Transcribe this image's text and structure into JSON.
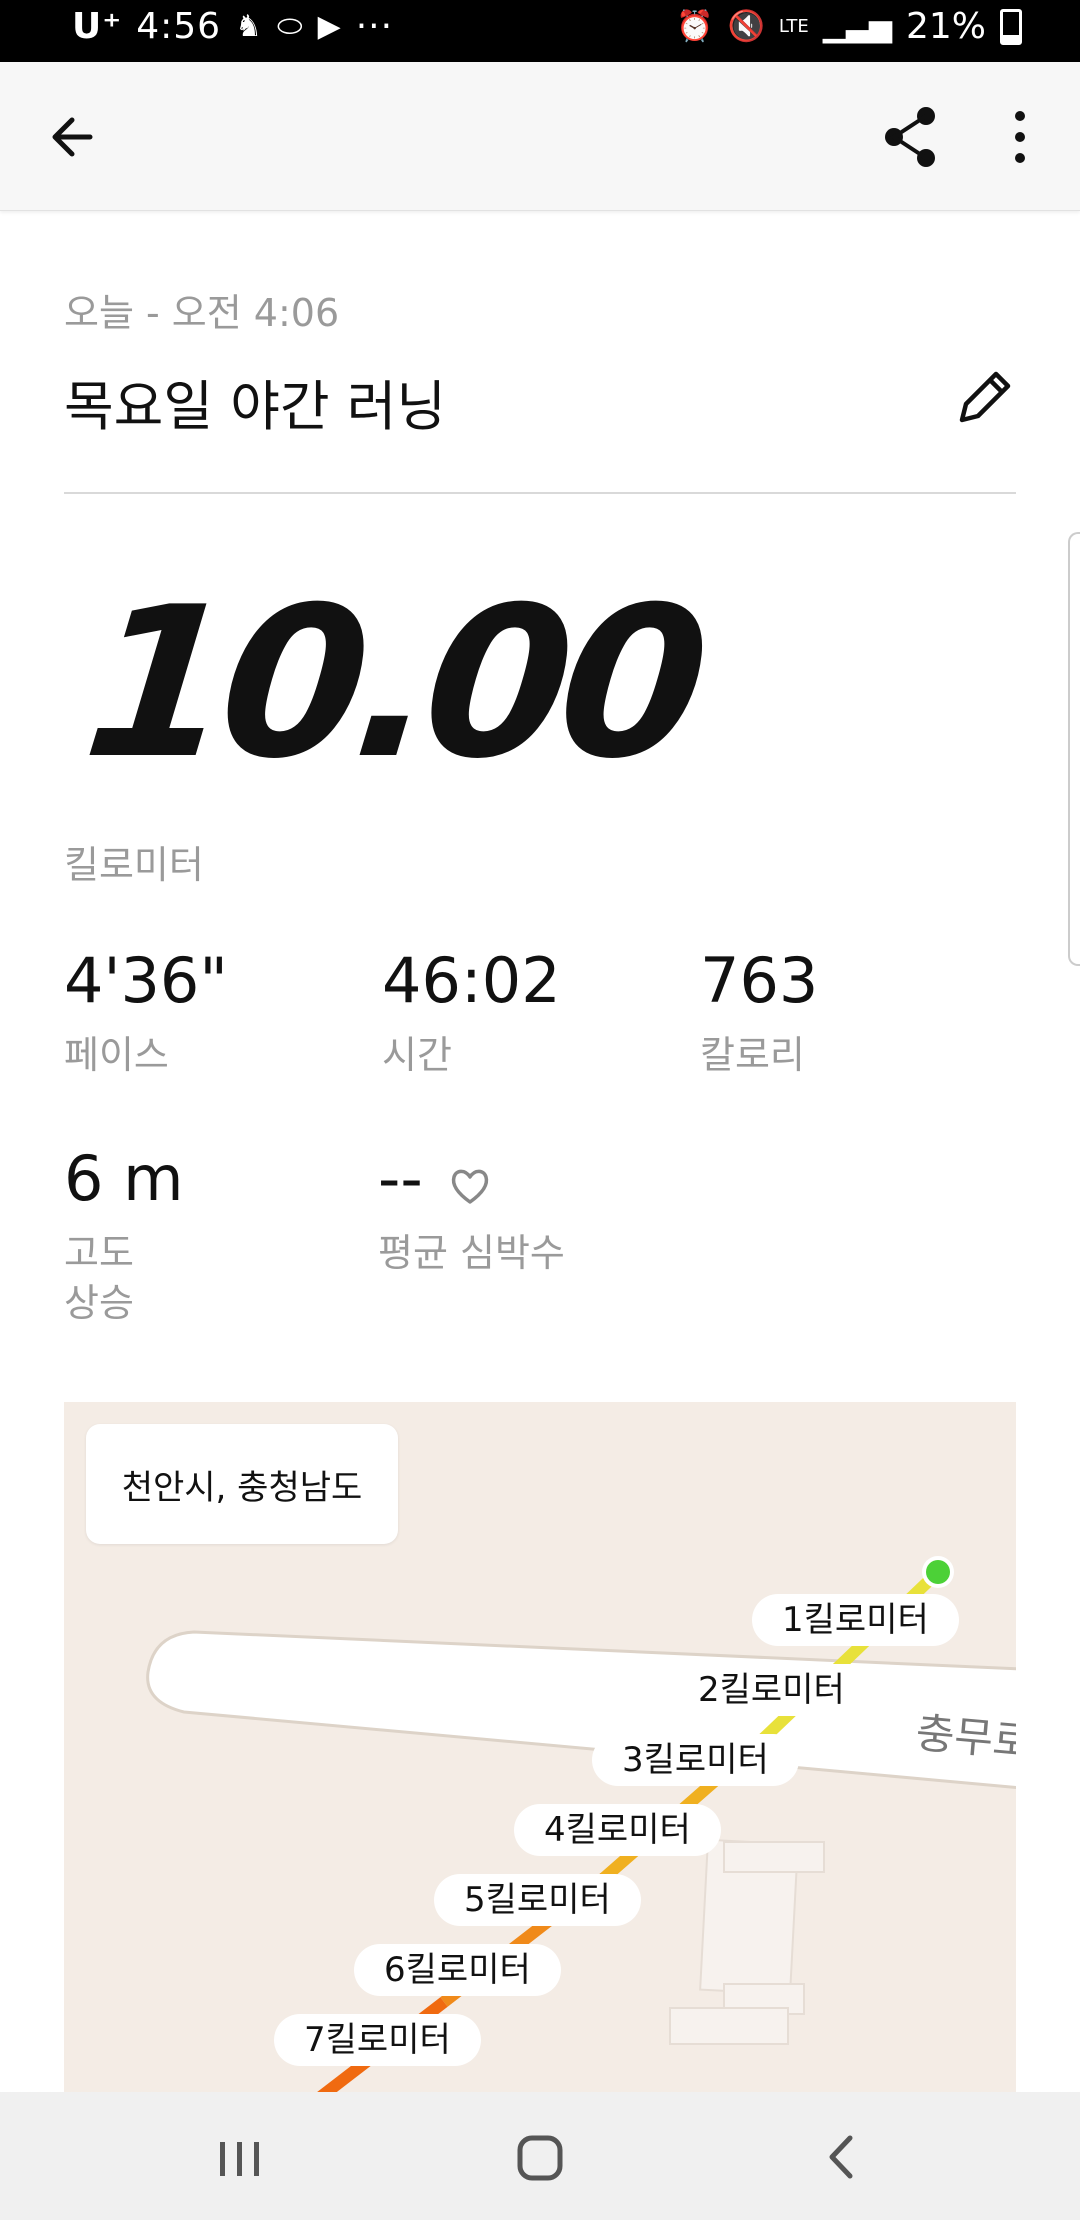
{
  "status_bar": {
    "carrier": "U⁺",
    "time": "4:56",
    "more": "···",
    "network": "LTE",
    "battery": "21%"
  },
  "header": {
    "date": "오늘 - 오전 4:06",
    "title": "목요일 야간 러닝"
  },
  "summary": {
    "distance": "10.00",
    "distance_unit": "킬로미터",
    "pace_value": "4'36\"",
    "pace_label": "페이스",
    "time_value": "46:02",
    "time_label": "시간",
    "calories_value": "763",
    "calories_label": "칼로리",
    "elevation_value": "6 m",
    "elevation_label_line1": "고도",
    "elevation_label_line2": "상승",
    "heartrate_value": "--",
    "heartrate_label": "평균 심박수"
  },
  "map": {
    "location": "천안시, 충청남도",
    "road_name": "충무로",
    "km_markers": [
      "1킬로미터",
      "2킬로미터",
      "3킬로미터",
      "4킬로미터",
      "5킬로미터",
      "6킬로미터",
      "7킬로미터"
    ],
    "start_color": "#4cd137",
    "route_colors": [
      "#e8e13a",
      "#f0b020",
      "#f08a1a",
      "#f06a10"
    ]
  },
  "icons": {
    "back": "arrow-left-icon",
    "share": "share-icon",
    "more": "more-vert-icon",
    "edit": "pencil-icon",
    "heart": "heart-outline-icon"
  }
}
